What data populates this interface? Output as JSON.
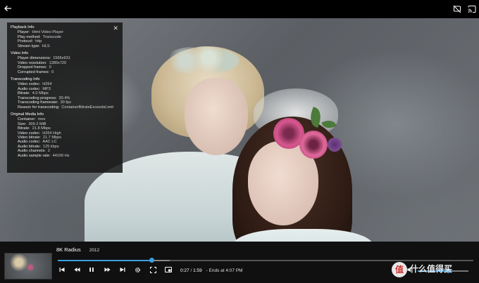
{
  "top_bar": {
    "back_icon": "arrow-left-icon",
    "cast_off_icon": "cast-off-icon",
    "cast_icon": "cast-icon"
  },
  "info_panel": {
    "close_icon": "close-icon",
    "sections": [
      {
        "title": "Playback Info",
        "rows": [
          {
            "k": "Player:",
            "v": "Html Video Player"
          },
          {
            "k": "Play method:",
            "v": "Transcode"
          },
          {
            "k": "Protocol:",
            "v": "http"
          },
          {
            "k": "Stream type:",
            "v": "HLS"
          }
        ]
      },
      {
        "title": "Video Info",
        "rows": [
          {
            "k": "Player dimensions:",
            "v": "1566x931"
          },
          {
            "k": "Video resolution:",
            "v": "1280x720"
          },
          {
            "k": "Dropped frames:",
            "v": "0"
          },
          {
            "k": "Corrupted frames:",
            "v": "0"
          }
        ]
      },
      {
        "title": "Transcoding Info",
        "rows": [
          {
            "k": "Video codec:",
            "v": "H264"
          },
          {
            "k": "Audio codec:",
            "v": "MP3"
          },
          {
            "k": "Bitrate:",
            "v": "4.0 Mbps"
          },
          {
            "k": "Transcoding progress:",
            "v": "30.4%"
          },
          {
            "k": "Transcoding framerate:",
            "v": "30 fps"
          },
          {
            "k": "Reason for transcoding:",
            "v": "ContainerBitrateExceedsLimit"
          }
        ]
      },
      {
        "title": "Original Media Info",
        "rows": [
          {
            "k": "Container:",
            "v": "mov"
          },
          {
            "k": "Size:",
            "v": "309.2 MiB"
          },
          {
            "k": "Bitrate:",
            "v": "21.8 Mbps"
          },
          {
            "k": "Video codec:",
            "v": "H264 High"
          },
          {
            "k": "Video bitrate:",
            "v": "21.7 Mbps"
          },
          {
            "k": "Audio codec:",
            "v": "AAC LC"
          },
          {
            "k": "Audio bitrate:",
            "v": "125 kbps"
          },
          {
            "k": "Audio channels:",
            "v": "2"
          },
          {
            "k": "Audio sample rate:",
            "v": "44100 Hz"
          }
        ]
      }
    ]
  },
  "now_playing": {
    "title": "8K Radius",
    "year": "2012"
  },
  "seek": {
    "played_fraction": 0.225,
    "buffered_fraction": 0.27
  },
  "controls": {
    "previous_icon": "skip-previous-icon",
    "rewind_icon": "rewind-icon",
    "pause_icon": "pause-icon",
    "forward_icon": "fast-forward-icon",
    "next_icon": "skip-next-icon",
    "settings_icon": "gear-icon",
    "fullscreen_icon": "fullscreen-icon",
    "pip_icon": "picture-in-picture-icon",
    "current_time": "0:27",
    "separator": "/",
    "duration": "1:59",
    "ends_at": "- Ends at 4:07 PM"
  },
  "volume": {
    "level": 0.6,
    "icon": "volume-icon"
  },
  "watermark": {
    "badge": "值",
    "text": "什么值得买"
  },
  "colors": {
    "accent": "#3c9fe0",
    "panel_bg": "#161616",
    "bar_bg": "#101010"
  }
}
